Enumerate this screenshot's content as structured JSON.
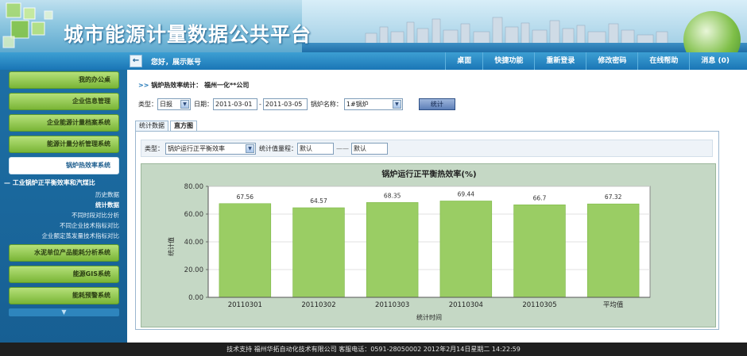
{
  "app": {
    "title": "城市能源计量数据公共平台"
  },
  "topnav": {
    "back_icon": "back-arrow-icon",
    "greeting": "您好，展示账号",
    "links": [
      "桌面",
      "快捷功能",
      "重新登录",
      "修改密码",
      "在线帮助",
      "消息 (0)"
    ]
  },
  "sidebar": {
    "items_top": [
      "我的办公桌",
      "企业信息管理",
      "企业能源计量档案系统",
      "能源计量分析管理系统"
    ],
    "active": "锅炉热效率系统",
    "subhead": "— 工业锅炉正平衡效率和汽煤比",
    "subitems": [
      "历史数据",
      "统计数据",
      "不同时段对比分析",
      "不同企业技术指标对比",
      "企业额定蒸发量技术指标对比"
    ],
    "current_subitem": "统计数据",
    "items_bottom": [
      "水泥单位产品能耗分析系统",
      "能源GIS系统",
      "能耗预警系统"
    ]
  },
  "breadcrumb": {
    "prefix": ">>",
    "title": "锅炉热效率统计：",
    "company": "福州一化**公司"
  },
  "filter": {
    "type_label": "类型：",
    "type_value": "日报",
    "date_label": "日期：",
    "date_from": "2011-03-01",
    "date_sep": "-",
    "date_to": "2011-03-05",
    "boiler_label": "锅炉名称：",
    "boiler_value": "1#锅炉",
    "submit_label": "统计"
  },
  "tabs": [
    "统计数据",
    "直方图"
  ],
  "chart_options": {
    "type_label": "类型：",
    "type_value": "锅炉运行正平衡效率",
    "range_label": "统计值量程：",
    "range_from": "默认",
    "range_sep": "——",
    "range_to": "默认"
  },
  "chart_data": {
    "type": "bar",
    "title": "锅炉运行正平衡热效率(%)",
    "xlabel": "统计时间",
    "ylabel": "统计值",
    "categories": [
      "20110301",
      "20110302",
      "20110303",
      "20110304",
      "20110305",
      "平均值"
    ],
    "values": [
      67.56,
      64.57,
      68.35,
      69.44,
      66.7,
      67.32
    ],
    "value_labels": [
      "67.56",
      "64.57",
      "68.35",
      "69.44",
      "66.7",
      "67.32"
    ],
    "yticks": [
      "0.00",
      "20.00",
      "40.00",
      "60.00",
      "80.00"
    ],
    "ylim": [
      0,
      80
    ],
    "grid": true,
    "colors": {
      "bar": "#9acd64",
      "plot_bg": "#ffffff",
      "frame_bg": "#c5d8c5"
    }
  },
  "footer": {
    "text": "技术支持 福州华拓自动化技术有限公司 客服电话：0591-28050002 2012年2月14日星期二 14:22:59"
  }
}
